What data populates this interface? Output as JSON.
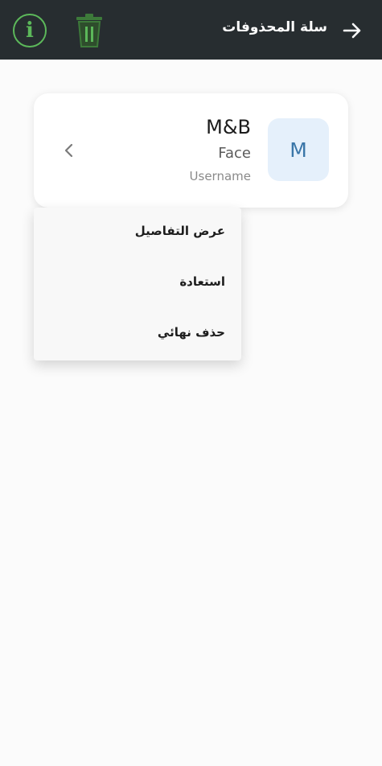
{
  "app_bar": {
    "title": "سلة المحذوفات",
    "icons": [
      "info-icon",
      "trash-icon",
      "arrow-right-icon"
    ],
    "background": "#272d30",
    "accent": "#5cb85a"
  },
  "item": {
    "avatar_letter": "M",
    "name": "M&B",
    "type": "Face",
    "subtitle": "Username",
    "avatar_bg": "#e5f0fb"
  },
  "menu": {
    "items": [
      "عرض التفاصيل",
      "استعادة",
      "حذف نهائي"
    ]
  }
}
